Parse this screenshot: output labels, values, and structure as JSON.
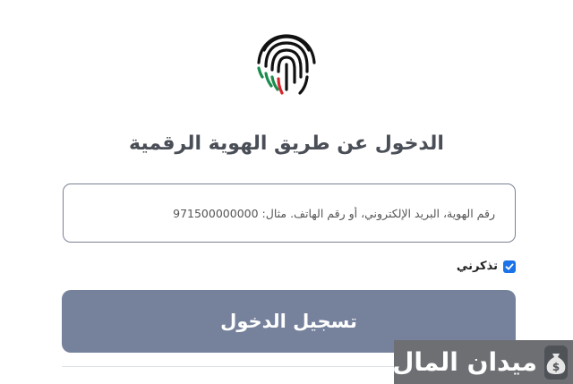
{
  "page": {
    "title": "الدخول عن طريق الهوية الرقمية",
    "brand_colors": {
      "fingerprint_black": "#111111",
      "uae_red": "#d7262c",
      "uae_green": "#1c8c4e"
    }
  },
  "form": {
    "identity_placeholder": "رقم الهوية، البريد الإلكتروني، أو رقم الهاتف. مثال: 971500000000",
    "identity_value": "",
    "remember_label": "تذكرني",
    "remember_checked": true,
    "login_label": "تسجيل الدخول",
    "login_button_color": "#76819c"
  },
  "watermark": {
    "text": "ميدان المال",
    "icon": "money-bag-icon"
  }
}
